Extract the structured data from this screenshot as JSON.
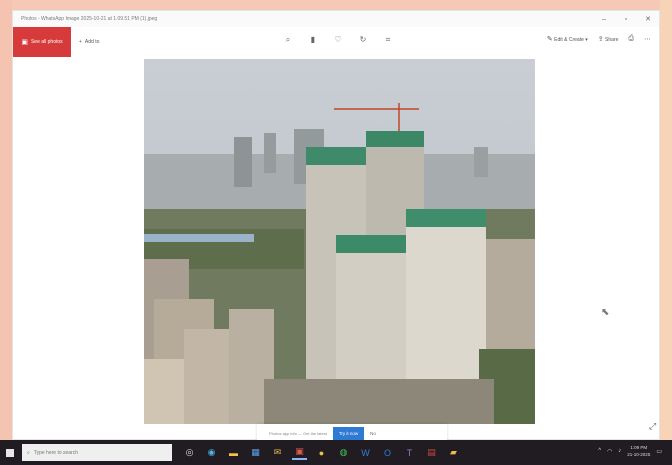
{
  "window": {
    "title": "Photos - WhatsApp Image 2025-10-21 at 1.09.51 PM (1).jpeg",
    "controls": [
      "minimize",
      "maximize",
      "close"
    ]
  },
  "toolbar": {
    "see_all_label": "See all photos",
    "add_label": "Add to",
    "center_tools": [
      "zoom-in-icon",
      "delete-icon",
      "favorite-icon",
      "rotate-icon",
      "crop-icon"
    ],
    "edit_create_label": "Edit & Create",
    "share_label": "Share",
    "print_icon": "print-icon",
    "more_icon": "more-icon"
  },
  "strip": {
    "caption": "Photos app info — Get the latest",
    "primary_label": "Try it now",
    "secondary_label": "No"
  },
  "taskbar": {
    "search_placeholder": "Type here to search",
    "apps": [
      "task-view",
      "edge",
      "file-explorer",
      "store",
      "mail",
      "photos",
      "chrome",
      "whatsapp",
      "word",
      "outlook",
      "teams",
      "calendar",
      "folder"
    ],
    "time": "1:09 PM",
    "date": "21-10-2025"
  },
  "colors": {
    "accent_red": "#d63a3a",
    "accent_blue": "#2f7bd3",
    "taskbar": "#201c22",
    "frame_peach": "#f3c8b4"
  }
}
